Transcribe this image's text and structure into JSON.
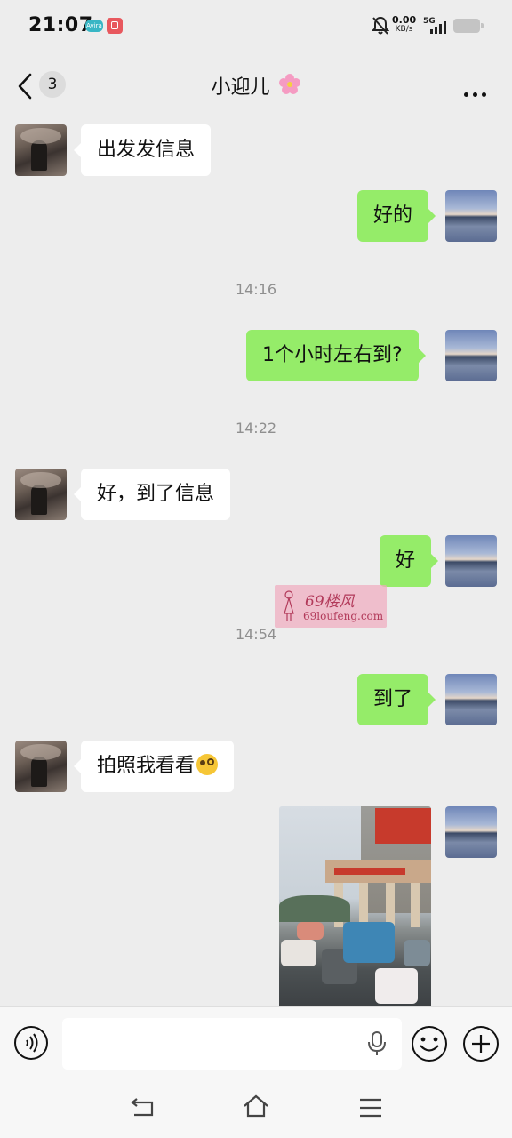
{
  "status_bar": {
    "time": "21:07",
    "app_badge": "Avira",
    "net_speed": "0.00",
    "net_unit": "KB/s",
    "network": "5G"
  },
  "header": {
    "unread_count": "3",
    "title": "小迎儿"
  },
  "messages": [
    {
      "side": "in",
      "text": "出发发信息"
    },
    {
      "side": "out",
      "text": "好的"
    },
    {
      "type": "time",
      "text": "14:16"
    },
    {
      "side": "out",
      "text": "1个小时左右到?"
    },
    {
      "type": "time",
      "text": "14:22"
    },
    {
      "side": "in",
      "text": "好，到了信息"
    },
    {
      "side": "out",
      "text": "好"
    },
    {
      "type": "time",
      "text": "14:54"
    },
    {
      "side": "out",
      "text": "到了"
    },
    {
      "side": "in",
      "text": "拍照我看看",
      "emoji": "thinking-face"
    },
    {
      "side": "out",
      "type": "image",
      "alt": "photo of hotel entrance with parked scooters"
    }
  ],
  "watermark": {
    "brand": "69楼风",
    "url": "69loufeng.com"
  },
  "input_bar": {
    "placeholder": ""
  },
  "colors": {
    "background": "#ededed",
    "incoming": "#ffffff",
    "outgoing": "#95ec69"
  }
}
